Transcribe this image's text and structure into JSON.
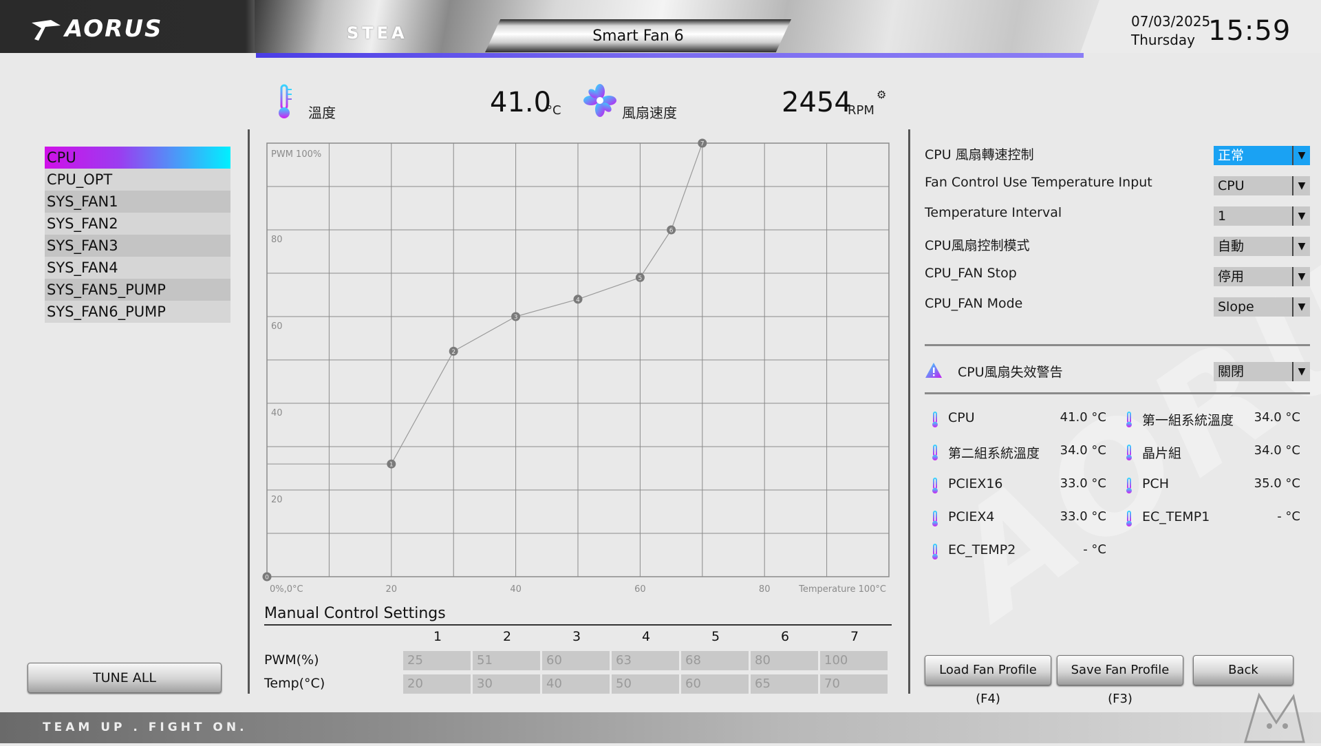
{
  "header": {
    "logo_text": "AORUS",
    "brand_text": "STEA",
    "tab_title": "Smart Fan 6",
    "date": "07/03/2025",
    "weekday": "Thursday",
    "time": "15:59"
  },
  "readouts": {
    "temp_label": "溫度",
    "temp_value": "41.0",
    "temp_unit": "°C",
    "fan_label": "風扇速度",
    "fan_value": "2454",
    "fan_unit": "RPM"
  },
  "fans": [
    "CPU",
    "CPU_OPT",
    "SYS_FAN1",
    "SYS_FAN2",
    "SYS_FAN3",
    "SYS_FAN4",
    "SYS_FAN5_PUMP",
    "SYS_FAN6_PUMP"
  ],
  "selected_fan": "CPU",
  "tune_all_label": "TUNE ALL",
  "chart_data": {
    "type": "line",
    "title": "",
    "ylabel": "PWM 100%",
    "xlabel": "Temperature 100°C",
    "origin_label": "0%,0°C",
    "xlim": [
      0,
      100
    ],
    "ylim": [
      0,
      100
    ],
    "x_ticks": [
      "20",
      "40",
      "60",
      "80"
    ],
    "y_ticks": [
      "20",
      "40",
      "60",
      "80"
    ],
    "grid": true,
    "series": [
      {
        "points": [
          {
            "label": "0",
            "x": 0,
            "y": 0
          },
          {
            "label": "1",
            "x": 20,
            "y": 26
          },
          {
            "label": "2",
            "x": 30,
            "y": 52
          },
          {
            "label": "3",
            "x": 40,
            "y": 60
          },
          {
            "label": "4",
            "x": 50,
            "y": 64
          },
          {
            "label": "5",
            "x": 60,
            "y": 69
          },
          {
            "label": "6",
            "x": 65,
            "y": 80
          },
          {
            "label": "7",
            "x": 70,
            "y": 100
          }
        ]
      }
    ],
    "flat_start": {
      "y": 26
    }
  },
  "manual": {
    "title": "Manual Control Settings",
    "columns": [
      "1",
      "2",
      "3",
      "4",
      "5",
      "6",
      "7"
    ],
    "pwm_label": "PWM(%)",
    "temp_label": "Temp(°C)",
    "pwm": [
      "25",
      "51",
      "60",
      "63",
      "68",
      "80",
      "100"
    ],
    "temp": [
      "20",
      "30",
      "40",
      "50",
      "60",
      "65",
      "70"
    ]
  },
  "settings": [
    {
      "label": "CPU 風扇轉速控制",
      "value": "正常",
      "highlight": true
    },
    {
      "label": "Fan Control Use Temperature Input",
      "value": "CPU",
      "highlight": false
    },
    {
      "label": "Temperature Interval",
      "value": "1",
      "highlight": false
    },
    {
      "label": "CPU風扇控制模式",
      "value": "自動",
      "highlight": false
    },
    {
      "label": "CPU_FAN Stop",
      "value": "停用",
      "highlight": false
    },
    {
      "label": "CPU_FAN Mode",
      "value": "Slope",
      "highlight": false
    }
  ],
  "warning": {
    "label": "CPU風扇失效警告",
    "value": "關閉"
  },
  "temps": [
    {
      "name": "CPU",
      "value": "41.0 °C"
    },
    {
      "name": "第一組系統溫度",
      "value": "34.0 °C"
    },
    {
      "name": "第二組系統溫度",
      "value": "34.0 °C"
    },
    {
      "name": "晶片組",
      "value": "34.0 °C"
    },
    {
      "name": "PCIEX16",
      "value": "33.0 °C"
    },
    {
      "name": "PCH",
      "value": "35.0 °C"
    },
    {
      "name": "PCIEX4",
      "value": "33.0 °C"
    },
    {
      "name": "EC_TEMP1",
      "value": "- °C"
    },
    {
      "name": "EC_TEMP2",
      "value": "- °C"
    }
  ],
  "buttons": {
    "load": "Load Fan Profile (F4)",
    "save": "Save Fan Profile (F3)",
    "back": "Back"
  },
  "footer_slogan": "TEAM UP . FIGHT ON.",
  "colors": {
    "accent_blue": "#1aa2f3",
    "select_magenta": "#d010e8",
    "select_cyan": "#00f0ff",
    "header_purple": "#5b4eea"
  }
}
